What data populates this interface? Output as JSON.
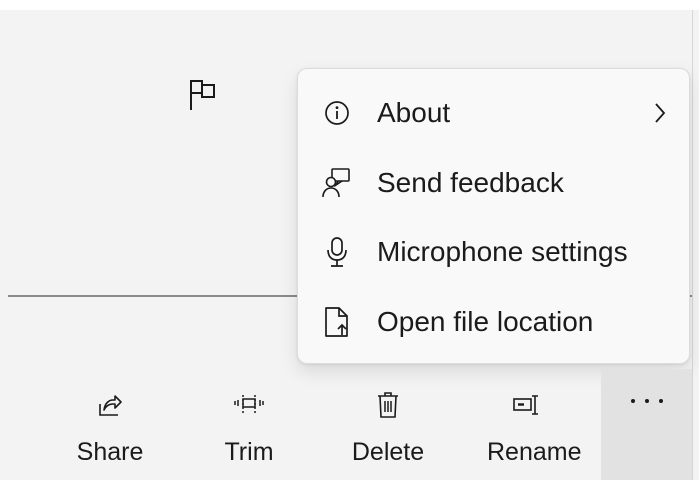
{
  "colors": {
    "background": "#f3f3f3",
    "menu_background": "#f9f9f9",
    "selected_button": "#e2e2e2",
    "text": "#1b1b1b",
    "separator": "#8a8a8a"
  },
  "flag": {
    "icon": "flag-icon"
  },
  "menu": {
    "items": [
      {
        "label": "About",
        "icon": "info-icon",
        "has_submenu": true
      },
      {
        "label": "Send feedback",
        "icon": "feedback-icon"
      },
      {
        "label": "Microphone settings",
        "icon": "microphone-icon"
      },
      {
        "label": "Open file location",
        "icon": "open-file-icon"
      }
    ]
  },
  "toolbar": {
    "share_label": "Share",
    "trim_label": "Trim",
    "delete_label": "Delete",
    "rename_label": "Rename",
    "more_icon": "more-icon"
  }
}
